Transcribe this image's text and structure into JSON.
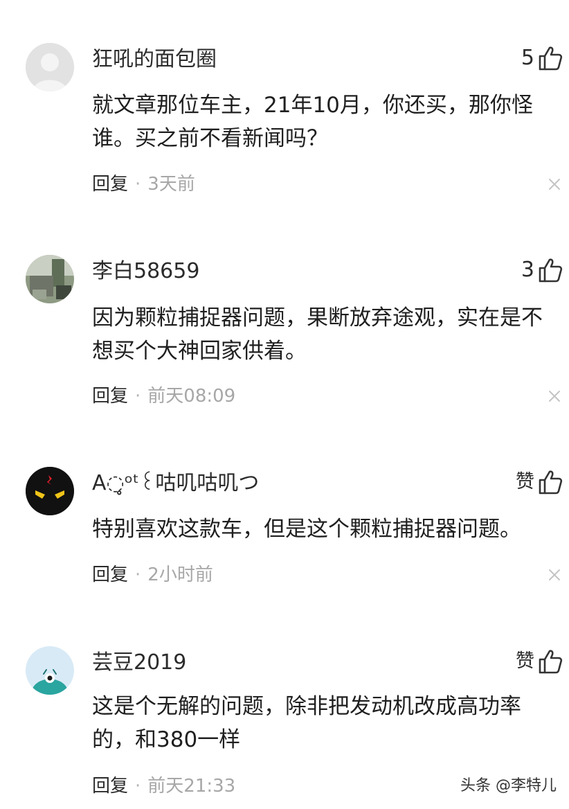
{
  "comments": [
    {
      "username": "狂吼的面包圈",
      "likes": "5",
      "text": "就文章那位车主，21年10月，你还买，那你怪谁。买之前不看新闻吗？",
      "reply_label": "回复",
      "separator": "·",
      "time": "3天前",
      "avatar_icon": "default-user-icon"
    },
    {
      "username": "李白58659",
      "likes": "3",
      "text": "因为颗粒捕捉器问题，果断放弃途观，实在是不想买个大神回家供着。",
      "reply_label": "回复",
      "separator": "·",
      "time": "前天08:09",
      "avatar_icon": "photo-avatar-icon"
    },
    {
      "username": "A◌̥ᵒᵗ꒰咕叽咕叽つ",
      "likes": "赞",
      "text": "特别喜欢这款车，但是这个颗粒捕捉器问题。",
      "reply_label": "回复",
      "separator": "·",
      "time": "2小时前",
      "avatar_icon": "devil-face-icon"
    },
    {
      "username": "芸豆2019",
      "likes": "赞",
      "text": "这是个无解的问题，除非把发动机改成高功率的，和380一样",
      "reply_label": "回复",
      "separator": "·",
      "time": "前天21:33",
      "avatar_icon": "cartoon-avatar-icon"
    }
  ],
  "watermark": "头条 @李特儿",
  "colors": {
    "text": "#222222",
    "meta": "#a7a7a7",
    "icon": "#333333"
  }
}
